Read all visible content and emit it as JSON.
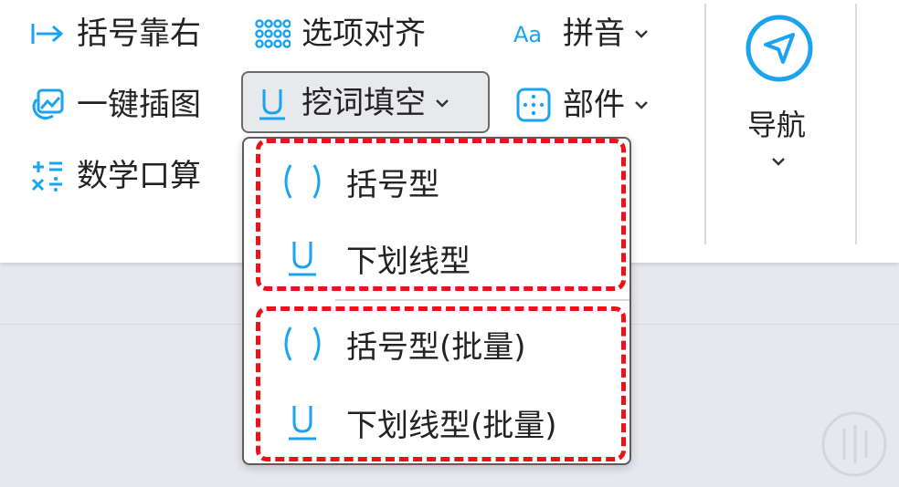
{
  "ribbon": {
    "col1": [
      "括号靠右",
      "一键插图",
      "数学口算"
    ],
    "col2": [
      "选项对齐",
      "挖词填空"
    ],
    "col3": [
      "拼音",
      "部件"
    ],
    "nav_label": "导航"
  },
  "dropdown": {
    "items": [
      "括号型",
      "下划线型",
      "括号型(批量)",
      "下划线型(批量)"
    ]
  },
  "colors": {
    "accent": "#1aa4f0",
    "highlight": "#e8141b"
  }
}
